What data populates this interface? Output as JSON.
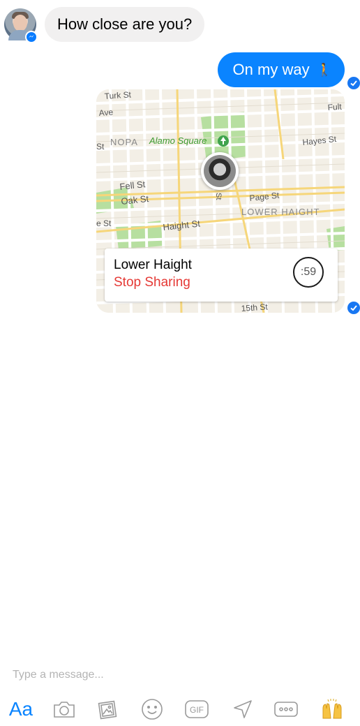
{
  "conversation": {
    "incoming": {
      "text": "How close are you?"
    },
    "outgoing": {
      "text": "On my way",
      "emoji": "🚶"
    }
  },
  "location_share": {
    "place": "Lower Haight",
    "action": "Stop Sharing",
    "timer": ":59",
    "map_labels": {
      "turk": "Turk St",
      "ave": "Ave",
      "fulton": "Fult",
      "st": "St",
      "nopa": "NOPA",
      "alamo": "Alamo Square",
      "hayes": "Hayes St",
      "fell": "Fell St",
      "oak": "Oak St",
      "page": "Page St",
      "lower_haight": "LOWER HAIGHT",
      "e_st": "e St",
      "haight": "Haight St",
      "fifteenth": "15th St",
      "vertical_st": "St"
    }
  },
  "composer": {
    "placeholder": "Type a message...",
    "aa_label": "Aa"
  },
  "colors": {
    "accent": "#0a84ff",
    "incoming_bubble": "#f1f0f0",
    "stop_sharing": "#e53935",
    "park": "#b7dfa0"
  }
}
